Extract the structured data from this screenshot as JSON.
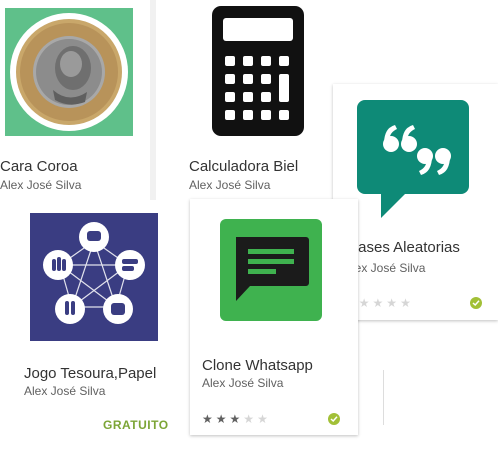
{
  "apps": [
    {
      "title": "Cara Coroa",
      "author": "Alex José Silva"
    },
    {
      "title": "Calculadora Biel",
      "author": "Alex José Silva"
    },
    {
      "title": "Frases Aleatorias",
      "author": "Alex José Silva",
      "rating": 0,
      "icon": "chat-quote-icon"
    },
    {
      "title": "Jogo Tesoura,Papel",
      "author": "Alex José Silva",
      "price": "GRATUITO"
    },
    {
      "title": "Clone Whatsapp",
      "author": "Alex José Silva",
      "rating": 3,
      "icon": "chat-message-icon"
    }
  ],
  "colors": {
    "coin_bg": "#5fc08a",
    "quote_green": "#0e8a77",
    "rps_bg": "#3a3d82",
    "whatsapp_green": "#3fb24f",
    "price_green": "#7ca536",
    "check_green": "#a2c037"
  }
}
